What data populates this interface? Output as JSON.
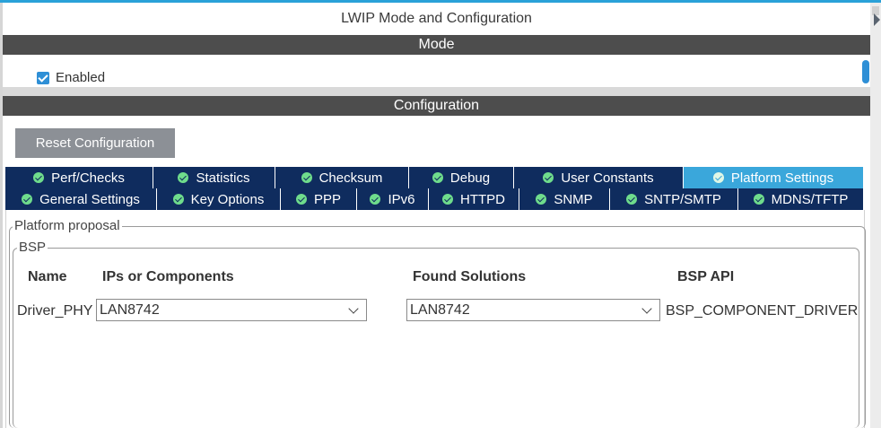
{
  "window": {
    "title": "LWIP Mode and Configuration"
  },
  "mode": {
    "header": "Mode",
    "enabled": {
      "label": "Enabled",
      "checked": true
    }
  },
  "configuration": {
    "header": "Configuration",
    "reset_button": "Reset Configuration",
    "tabs_row1": [
      {
        "label": "Perf/Checks",
        "active": false
      },
      {
        "label": "Statistics",
        "active": false
      },
      {
        "label": "Checksum",
        "active": false
      },
      {
        "label": "Debug",
        "active": false
      },
      {
        "label": "User Constants",
        "active": false
      },
      {
        "label": "Platform Settings",
        "active": true
      }
    ],
    "tabs_row2": [
      {
        "label": "General Settings",
        "active": false
      },
      {
        "label": "Key Options",
        "active": false
      },
      {
        "label": "PPP",
        "active": false
      },
      {
        "label": "IPv6",
        "active": false
      },
      {
        "label": "HTTPD",
        "active": false
      },
      {
        "label": "SNMP",
        "active": false
      },
      {
        "label": "SNTP/SMTP",
        "active": false
      },
      {
        "label": "MDNS/TFTP",
        "active": false
      }
    ],
    "platform": {
      "group_label": "Platform proposal",
      "bsp_label": "BSP",
      "columns": {
        "name": "Name",
        "ips": "IPs or Components",
        "found": "Found Solutions",
        "api": "BSP API"
      },
      "row": {
        "name": "Driver_PHY",
        "ip_value": "LAN8742",
        "found_value": "LAN8742",
        "api_value": "BSP_COMPONENT_DRIVER"
      }
    }
  },
  "colors": {
    "accent": "#2aa1d8",
    "tab_bg": "#0f2c5e",
    "tab_active": "#3aa7db",
    "section_bar": "#4d4d4d",
    "button_gray": "#8c9096"
  }
}
